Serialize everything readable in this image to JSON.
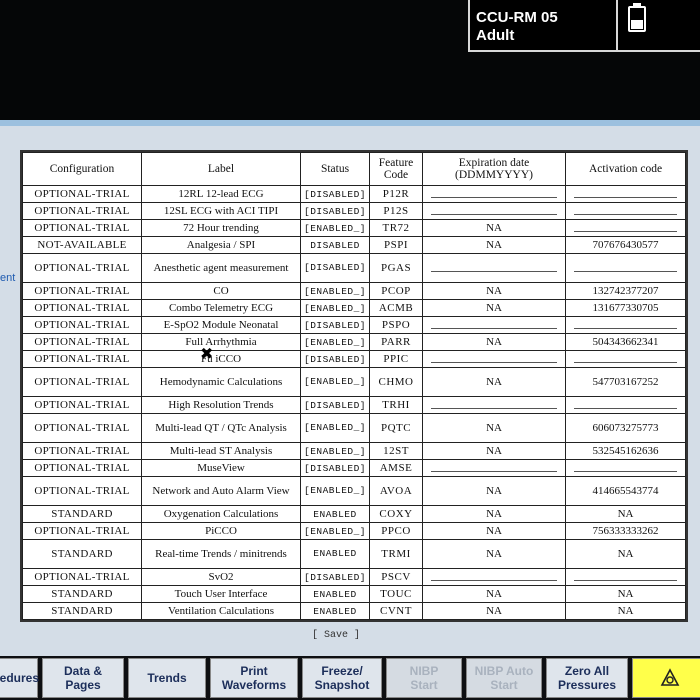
{
  "patient": {
    "bed": "CCU-RM 05",
    "type": "Adult"
  },
  "side_link": "ent",
  "table": {
    "headers": {
      "configuration": "Configuration",
      "label": "Label",
      "status": "Status",
      "feature_code": "Feature Code",
      "expiration": "Expiration date (DDMMYYYY)",
      "activation": "Activation code"
    },
    "rows": [
      {
        "cfg": "OPTIONAL-TRIAL",
        "label": "12RL 12-lead ECG",
        "status": "[DISABLED]",
        "code": "P12R",
        "exp": "",
        "act": ""
      },
      {
        "cfg": "OPTIONAL-TRIAL",
        "label": "12SL ECG with ACI TIPI",
        "status": "[DISABLED]",
        "code": "P12S",
        "exp": "",
        "act": ""
      },
      {
        "cfg": "OPTIONAL-TRIAL",
        "label": "72 Hour trending",
        "status": "[ENABLED_]",
        "code": "TR72",
        "exp": "NA",
        "act": ""
      },
      {
        "cfg": "NOT-AVAILABLE",
        "label": "Analgesia / SPI",
        "status": "DISABLED",
        "code": "PSPI",
        "exp": "NA",
        "act": "707676430577"
      },
      {
        "cfg": "OPTIONAL-TRIAL",
        "label": "Anesthetic agent measurement",
        "status": "[DISABLED]",
        "code": "PGAS",
        "exp": "",
        "act": "",
        "tall": true
      },
      {
        "cfg": "OPTIONAL-TRIAL",
        "label": "CO",
        "status": "[ENABLED_]",
        "code": "PCOP",
        "exp": "NA",
        "act": "132742377207"
      },
      {
        "cfg": "OPTIONAL-TRIAL",
        "label": "Combo Telemetry ECG",
        "status": "[ENABLED_]",
        "code": "ACMB",
        "exp": "NA",
        "act": "131677330705"
      },
      {
        "cfg": "OPTIONAL-TRIAL",
        "label": "E-SpO2 Module Neonatal",
        "status": "[DISABLED]",
        "code": "PSPO",
        "exp": "",
        "act": ""
      },
      {
        "cfg": "OPTIONAL-TRIAL",
        "label": "Full Arrhythmia",
        "status": "[ENABLED_]",
        "code": "PARR",
        "exp": "NA",
        "act": "504343662341"
      },
      {
        "cfg": "OPTIONAL-TRIAL",
        "label": "Fu iCCO",
        "status": "[DISABLED]",
        "code": "PPIC",
        "exp": "",
        "act": ""
      },
      {
        "cfg": "OPTIONAL-TRIAL",
        "label": "Hemodynamic Calculations",
        "status": "[ENABLED_]",
        "code": "CHMO",
        "exp": "NA",
        "act": "547703167252",
        "tall": true
      },
      {
        "cfg": "OPTIONAL-TRIAL",
        "label": "High Resolution Trends",
        "status": "[DISABLED]",
        "code": "TRHI",
        "exp": "",
        "act": ""
      },
      {
        "cfg": "OPTIONAL-TRIAL",
        "label": "Multi-lead QT / QTc Analysis",
        "status": "[ENABLED_]",
        "code": "PQTC",
        "exp": "NA",
        "act": "606073275773",
        "tall": true
      },
      {
        "cfg": "OPTIONAL-TRIAL",
        "label": "Multi-lead ST Analysis",
        "status": "[ENABLED_]",
        "code": "12ST",
        "exp": "NA",
        "act": "532545162636"
      },
      {
        "cfg": "OPTIONAL-TRIAL",
        "label": "MuseView",
        "status": "[DISABLED]",
        "code": "AMSE",
        "exp": "",
        "act": ""
      },
      {
        "cfg": "OPTIONAL-TRIAL",
        "label": "Network and Auto Alarm View",
        "status": "[ENABLED_]",
        "code": "AVOA",
        "exp": "NA",
        "act": "414665543774",
        "tall": true
      },
      {
        "cfg": "STANDARD",
        "label": "Oxygenation Calculations",
        "status": "ENABLED",
        "code": "COXY",
        "exp": "NA",
        "act": "NA"
      },
      {
        "cfg": "OPTIONAL-TRIAL",
        "label": "PiCCO",
        "status": "[ENABLED_]",
        "code": "PPCO",
        "exp": "NA",
        "act": "756333333262"
      },
      {
        "cfg": "STANDARD",
        "label": "Real-time Trends / minitrends",
        "status": "ENABLED",
        "code": "TRMI",
        "exp": "NA",
        "act": "NA",
        "tall": true
      },
      {
        "cfg": "OPTIONAL-TRIAL",
        "label": "SvO2",
        "status": "[DISABLED]",
        "code": "PSCV",
        "exp": "",
        "act": ""
      },
      {
        "cfg": "STANDARD",
        "label": "Touch User Interface",
        "status": "ENABLED",
        "code": "TOUC",
        "exp": "NA",
        "act": "NA"
      },
      {
        "cfg": "STANDARD",
        "label": "Ventilation Calculations",
        "status": "ENABLED",
        "code": "CVNT",
        "exp": "NA",
        "act": "NA"
      }
    ]
  },
  "save_label": "[ Save ]",
  "buttons": [
    {
      "label": "cedures",
      "name": "procedures-button",
      "disabled": false
    },
    {
      "label": "Data &\nPages",
      "name": "data-pages-button",
      "disabled": false
    },
    {
      "label": "Trends",
      "name": "trends-button",
      "disabled": false
    },
    {
      "label": "Print\nWaveforms",
      "name": "print-waveforms-button",
      "disabled": false
    },
    {
      "label": "Freeze/\nSnapshot",
      "name": "freeze-snapshot-button",
      "disabled": false
    },
    {
      "label": "NIBP\nStart",
      "name": "nibp-start-button",
      "disabled": true
    },
    {
      "label": "NIBP Auto\nStart",
      "name": "nibp-auto-start-button",
      "disabled": true
    },
    {
      "label": "Zero All\nPressures",
      "name": "zero-all-pressures-button",
      "disabled": false
    },
    {
      "label": "",
      "name": "alarm-silence-button",
      "disabled": false,
      "alarm": true
    }
  ]
}
